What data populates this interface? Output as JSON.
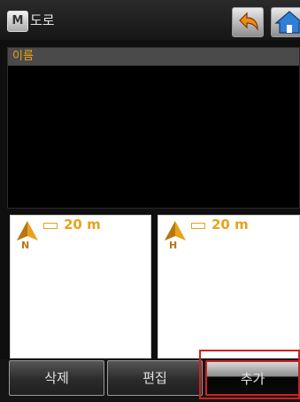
{
  "titlebar": {
    "app_icon_letter": "M",
    "title": "도로",
    "back_icon": "back-arrow-icon",
    "home_icon": "home-icon"
  },
  "name_panel": {
    "label": "이름",
    "value": ""
  },
  "maps": [
    {
      "orientation_letter": "N",
      "scale": "20 m"
    },
    {
      "orientation_letter": "H",
      "scale": "20 m"
    }
  ],
  "buttons": {
    "delete": "삭제",
    "edit": "편집",
    "add": "추가"
  },
  "colors": {
    "accent": "#e8a21c",
    "highlight": "#d02020"
  }
}
